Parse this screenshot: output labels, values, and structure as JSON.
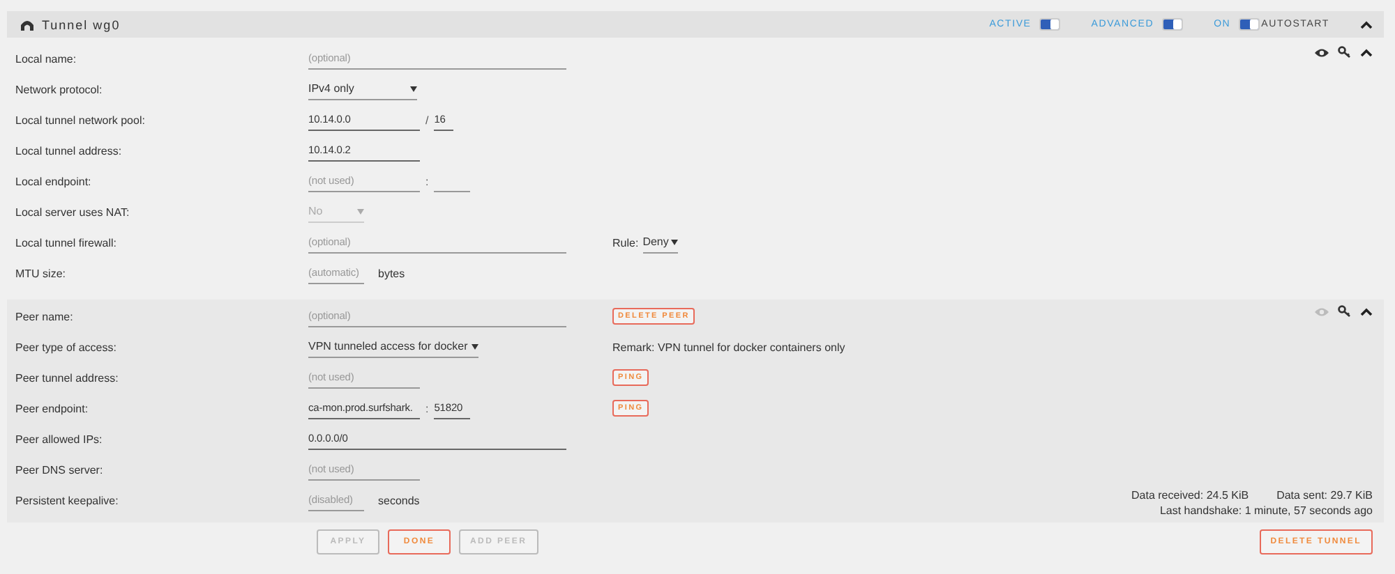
{
  "header": {
    "title": "Tunnel wg0",
    "toggles": [
      {
        "label": "ACTIVE",
        "on": true
      },
      {
        "label": "ADVANCED",
        "on": true
      },
      {
        "label": "ON",
        "on": true,
        "after": "AUTOSTART"
      }
    ]
  },
  "local": {
    "reveal_active": true,
    "rows": [
      {
        "label": "Local name:",
        "controls": [
          {
            "kind": "text",
            "placeholder": "(optional)"
          }
        ]
      },
      {
        "label": "Network protocol:",
        "controls": [
          {
            "kind": "select",
            "value": "IPv4 only",
            "disabled": false
          }
        ]
      },
      {
        "label": "Local tunnel network pool:",
        "controls": [
          {
            "kind": "address",
            "value": "10.14.0.0"
          },
          {
            "kind": "separator",
            "text": "/"
          },
          {
            "kind": "prefix",
            "value": "16"
          }
        ]
      },
      {
        "label": "Local tunnel address:",
        "controls": [
          {
            "kind": "address",
            "value": "10.14.0.2"
          }
        ]
      },
      {
        "label": "Local endpoint:",
        "controls": [
          {
            "kind": "address",
            "placeholder": "(not used)"
          },
          {
            "kind": "separator",
            "text": ":"
          },
          {
            "kind": "port"
          }
        ]
      },
      {
        "label": "Local server uses NAT:",
        "controls": [
          {
            "kind": "small_select",
            "value": "No",
            "disabled": true
          }
        ]
      },
      {
        "label": "Local tunnel firewall:",
        "controls": [
          {
            "kind": "text",
            "placeholder": "(optional)"
          }
        ],
        "side": [
          {
            "kind": "rule",
            "label": "Rule:",
            "value": "Deny"
          }
        ]
      },
      {
        "label": "MTU size:",
        "controls": [
          {
            "kind": "number",
            "placeholder": "(automatic)"
          },
          {
            "kind": "unit",
            "text": "bytes"
          }
        ]
      }
    ]
  },
  "peer": {
    "reveal_active": false,
    "rows": [
      {
        "label": "Peer name:",
        "controls": [
          {
            "kind": "text",
            "placeholder": "(optional)"
          }
        ],
        "side": [
          {
            "kind": "button",
            "text": "DELETE PEER"
          }
        ]
      },
      {
        "label": "Peer type of access:",
        "controls": [
          {
            "kind": "wide_select",
            "value": "VPN tunneled access for docker",
            "disabled": false
          }
        ],
        "side": [
          {
            "kind": "remark",
            "text": "Remark: VPN tunnel for docker containers only"
          }
        ]
      },
      {
        "label": "Peer tunnel address:",
        "controls": [
          {
            "kind": "address",
            "placeholder": "(not used)"
          }
        ],
        "side": [
          {
            "kind": "button",
            "text": "PING"
          }
        ]
      },
      {
        "label": "Peer endpoint:",
        "controls": [
          {
            "kind": "address",
            "value": "ca-mon.prod.surfshark."
          },
          {
            "kind": "separator",
            "text": ":"
          },
          {
            "kind": "port",
            "value": "51820"
          }
        ],
        "side": [
          {
            "kind": "button",
            "text": "PING"
          }
        ]
      },
      {
        "label": "Peer allowed IPs:",
        "controls": [
          {
            "kind": "text",
            "value": "0.0.0.0/0"
          }
        ]
      },
      {
        "label": "Peer DNS server:",
        "controls": [
          {
            "kind": "address",
            "placeholder": "(not used)"
          }
        ]
      },
      {
        "label": "Persistent keepalive:",
        "controls": [
          {
            "kind": "number",
            "placeholder": "(disabled)"
          },
          {
            "kind": "unit",
            "text": "seconds"
          }
        ]
      }
    ],
    "stats": {
      "received": "Data received: 24.5 KiB",
      "sent": "Data sent: 29.7 KiB",
      "handshake": "Last handshake: 1 minute, 57 seconds ago"
    }
  },
  "actions": [
    {
      "text": "APPLY",
      "disabled": true
    },
    {
      "text": "DONE",
      "disabled": false
    },
    {
      "text": "ADD PEER",
      "disabled": true
    }
  ],
  "delete_tunnel": "DELETE TUNNEL"
}
